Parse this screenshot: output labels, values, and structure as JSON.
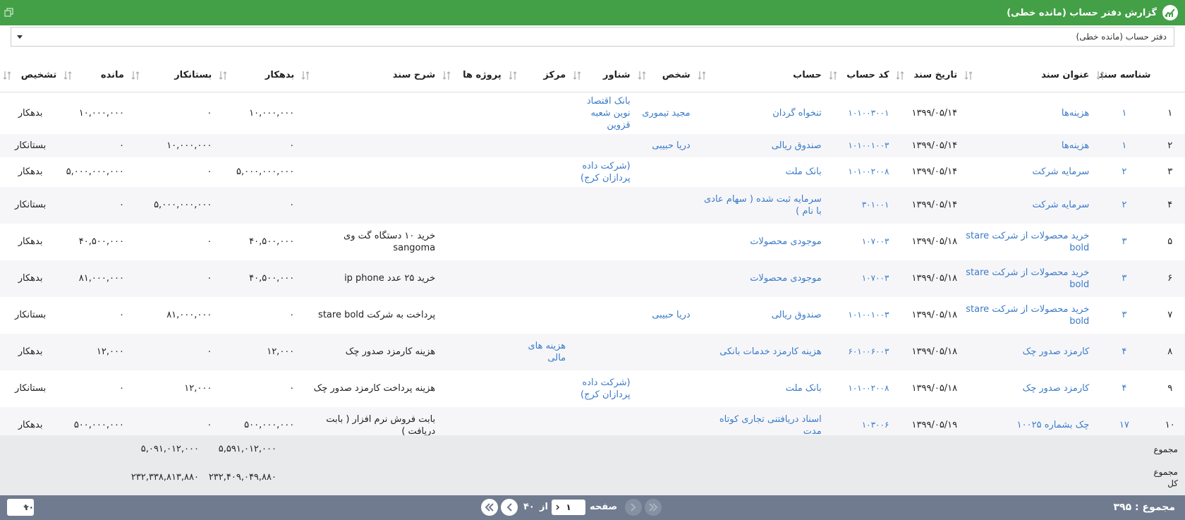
{
  "window": {
    "title": "گزارش دفتر حساب (مانده خطی)",
    "restore_icon": "restore-window-icon",
    "app_icon": "chart-icon"
  },
  "selector": {
    "value": "دفتر حساب (مانده خطی)"
  },
  "columns": {
    "doc_no": "شناسه سند",
    "doc_title": "عنوان سند",
    "doc_date": "تاریخ سند",
    "acc_code": "کد حساب",
    "account": "حساب",
    "person": "شخص",
    "floating": "شناور",
    "center": "مرکز",
    "projects": "پروژه ها",
    "desc": "شرح سند",
    "debit": "بدهکار",
    "credit": "بستانکار",
    "balance": "مانده",
    "diagnosis": "تشخیص"
  },
  "rows": [
    {
      "rn": "۱",
      "no": "۱",
      "title": "هزینه‌ها",
      "date": "۱۳۹۹/۰۵/۱۴",
      "code": "۱۰۱۰۰۳۰۰۱",
      "account": "تنخواه گردان",
      "person": "مجید تیموری",
      "floating": "بانک اقتصاد نوین شعبه قزوین",
      "center": "",
      "projects": "",
      "desc": "",
      "debit": "۱۰,۰۰۰,۰۰۰",
      "credit": "۰",
      "balance": "۱۰,۰۰۰,۰۰۰",
      "diag": "بدهکار"
    },
    {
      "rn": "۲",
      "no": "۱",
      "title": "هزینه‌ها",
      "date": "۱۳۹۹/۰۵/۱۴",
      "code": "۱۰۱۰۰۱۰۰۳",
      "account": "صندوق ریالی",
      "person": "دریا حبیبی",
      "floating": "",
      "center": "",
      "projects": "",
      "desc": "",
      "debit": "۰",
      "credit": "۱۰,۰۰۰,۰۰۰",
      "balance": "۰",
      "diag": "بستانکار"
    },
    {
      "rn": "۳",
      "no": "۲",
      "title": "سرمایه شرکت",
      "date": "۱۳۹۹/۰۵/۱۴",
      "code": "۱۰۱۰۰۲۰۰۸",
      "account": "بانک ملت",
      "person": "",
      "floating": "(شرکت داده پردازان کرج)",
      "center": "",
      "projects": "",
      "desc": "",
      "debit": "۵,۰۰۰,۰۰۰,۰۰۰",
      "credit": "۰",
      "balance": "۵,۰۰۰,۰۰۰,۰۰۰",
      "diag": "بدهکار"
    },
    {
      "rn": "۴",
      "no": "۲",
      "title": "سرمایه شرکت",
      "date": "۱۳۹۹/۰۵/۱۴",
      "code": "۳۰۱۰۰۱",
      "account": "سرمایه ثبت شده ( سهام عادی با نام )",
      "person": "",
      "floating": "",
      "center": "",
      "projects": "",
      "desc": "",
      "debit": "۰",
      "credit": "۵,۰۰۰,۰۰۰,۰۰۰",
      "balance": "۰",
      "diag": "بستانکار"
    },
    {
      "rn": "۵",
      "no": "۳",
      "title": "خرید محصولات از شرکت stare bold",
      "date": "۱۳۹۹/۰۵/۱۸",
      "code": "۱۰۷۰۰۳",
      "account": "موجودی محصولات",
      "person": "",
      "floating": "",
      "center": "",
      "projects": "",
      "desc": "خرید ۱۰ دستگاه گت وی sangoma",
      "debit": "۴۰,۵۰۰,۰۰۰",
      "credit": "۰",
      "balance": "۴۰,۵۰۰,۰۰۰",
      "diag": "بدهکار"
    },
    {
      "rn": "۶",
      "no": "۳",
      "title": "خرید محصولات از شرکت stare bold",
      "date": "۱۳۹۹/۰۵/۱۸",
      "code": "۱۰۷۰۰۳",
      "account": "موجودی محصولات",
      "person": "",
      "floating": "",
      "center": "",
      "projects": "",
      "desc": "خرید ۲۵ عدد ip phone",
      "debit": "۴۰,۵۰۰,۰۰۰",
      "credit": "۰",
      "balance": "۸۱,۰۰۰,۰۰۰",
      "diag": "بدهکار"
    },
    {
      "rn": "۷",
      "no": "۳",
      "title": "خرید محصولات از شرکت stare bold",
      "date": "۱۳۹۹/۰۵/۱۸",
      "code": "۱۰۱۰۰۱۰۰۳",
      "account": "صندوق ریالی",
      "person": "دریا حبیبی",
      "floating": "",
      "center": "",
      "projects": "",
      "desc": "پرداخت به شرکت stare bold",
      "debit": "۰",
      "credit": "۸۱,۰۰۰,۰۰۰",
      "balance": "۰",
      "diag": "بستانکار"
    },
    {
      "rn": "۸",
      "no": "۴",
      "title": "کارمزد صدور چک",
      "date": "۱۳۹۹/۰۵/۱۸",
      "code": "۶۰۱۰۰۶۰۰۳",
      "account": "هزینه کارمزد خدمات بانکی",
      "person": "",
      "floating": "",
      "center": "هزینه های مالی",
      "projects": "",
      "desc": "هزینه کارمزد صدور چک",
      "debit": "۱۲,۰۰۰",
      "credit": "۰",
      "balance": "۱۲,۰۰۰",
      "diag": "بدهکار"
    },
    {
      "rn": "۹",
      "no": "۴",
      "title": "کارمزد صدور چک",
      "date": "۱۳۹۹/۰۵/۱۸",
      "code": "۱۰۱۰۰۲۰۰۸",
      "account": "بانک ملت",
      "person": "",
      "floating": "(شرکت داده پردازان کرج)",
      "center": "",
      "projects": "",
      "desc": "هزینه پرداخت کارمزد صدور چک",
      "debit": "۰",
      "credit": "۱۲,۰۰۰",
      "balance": "۰",
      "diag": "بستانکار"
    },
    {
      "rn": "۱۰",
      "no": "۱۷",
      "title": "چک بشماره ۱۰۰۲۵",
      "date": "۱۳۹۹/۰۵/۱۹",
      "code": "۱۰۳۰۰۶",
      "account": "اسناد دریافتنی تجاری کوتاه مدت",
      "person": "",
      "floating": "",
      "center": "",
      "projects": "",
      "desc": "بابت فروش نرم افزار ( بابت دریافت )",
      "debit": "۵۰۰,۰۰۰,۰۰۰",
      "credit": "۰",
      "balance": "۵۰۰,۰۰۰,۰۰۰",
      "diag": "بدهکار"
    }
  ],
  "totals": {
    "sum_label": "مجموع",
    "sum_debit": "۵,۵۹۱,۰۱۲,۰۰۰",
    "sum_credit": "۵,۰۹۱,۰۱۲,۰۰۰",
    "grand_label": "مجموع کل",
    "grand_debit": "۲۳۲,۴۰۹,۰۴۹,۸۸۰",
    "grand_credit": "۲۳۲,۳۳۸,۸۱۳,۸۸۰"
  },
  "footer": {
    "count_label": "مجموع : ۳۹۵",
    "page_label": "صفحه",
    "page_value": "۱",
    "of_label": "از",
    "page_total": "۴۰",
    "page_size": "۱۰"
  },
  "colors": {
    "header_green": "#43a047",
    "link_blue": "#3a7bc8",
    "footer_gray": "#707b8f"
  }
}
